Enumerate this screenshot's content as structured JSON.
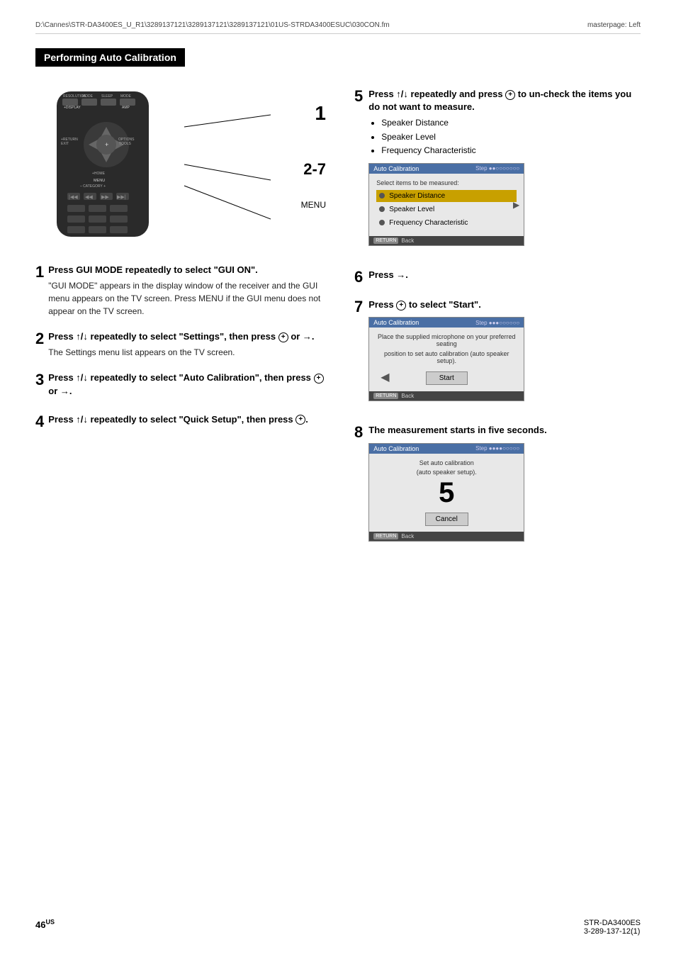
{
  "header": {
    "left": "D:\\Cannes\\STR-DA3400ES_U_R1\\3289137121\\3289137121\\3289137121\\01US-STRDA3400ESUC\\030CON.fm",
    "right": "masterpage: Left"
  },
  "section_title": "Performing Auto Calibration",
  "remote_labels": {
    "label1": "1",
    "label27": "2-7",
    "menu": "MENU"
  },
  "steps": [
    {
      "number": "1",
      "title": "Press GUI MODE repeatedly to select \"GUI ON\".",
      "body": "\"GUI MODE\" appears in the display window of the receiver and the GUI menu appears on the TV screen. Press MENU if the GUI menu does not appear on the TV screen."
    },
    {
      "number": "2",
      "title": "Press ↑/↓ repeatedly to select \"Settings\", then press ⊕ or →.",
      "body": "The Settings menu list appears on the TV screen."
    },
    {
      "number": "3",
      "title": "Press ↑/↓ repeatedly to select \"Auto Calibration\", then press ⊕ or →."
    },
    {
      "number": "4",
      "title": "Press ↑/↓ repeatedly to select \"Quick Setup\", then press ⊕."
    }
  ],
  "steps_right": [
    {
      "number": "5",
      "title": "Press ↑/↓ repeatedly and press ⊕ to un-check the items you do not want to measure.",
      "bullets": [
        "Speaker Distance",
        "Speaker Level",
        "Frequency Characteristic"
      ],
      "screen": {
        "header_title": "Auto Calibration",
        "step_label": "Step ●●○○○○○○○",
        "body_label": "Select items to be measured:",
        "items": [
          {
            "label": "Speaker Distance",
            "selected": true
          },
          {
            "label": "Speaker Level",
            "selected": false
          },
          {
            "label": "Frequency Characteristic",
            "selected": false
          }
        ],
        "footer_btn": "RETURN",
        "footer_label": "Back"
      }
    },
    {
      "number": "6",
      "title": "Press →."
    },
    {
      "number": "7",
      "title": "Press ⊕ to select \"Start\".",
      "screen": {
        "header_title": "Auto Calibration",
        "step_label": "Step ●●●○○○○○○",
        "body_text1": "Place the supplied microphone on your preferred seating",
        "body_text2": "position to set auto calibration (auto speaker setup).",
        "start_btn": "Start",
        "footer_btn": "RETURN",
        "footer_label": "Back"
      }
    },
    {
      "number": "8",
      "title": "The measurement starts in five seconds.",
      "screen": {
        "header_title": "Auto Calibration",
        "step_label": "Step ●●●●○○○○○",
        "body_text1": "Set auto calibration",
        "body_text2": "(auto speaker setup).",
        "countdown": "5",
        "cancel_btn": "Cancel",
        "footer_btn": "RETURN",
        "footer_label": "Back"
      }
    }
  ],
  "footer": {
    "page_num": "46",
    "page_sup": "US",
    "product": "STR-DA3400ES",
    "catalog": "3-289-137-12(1)"
  }
}
